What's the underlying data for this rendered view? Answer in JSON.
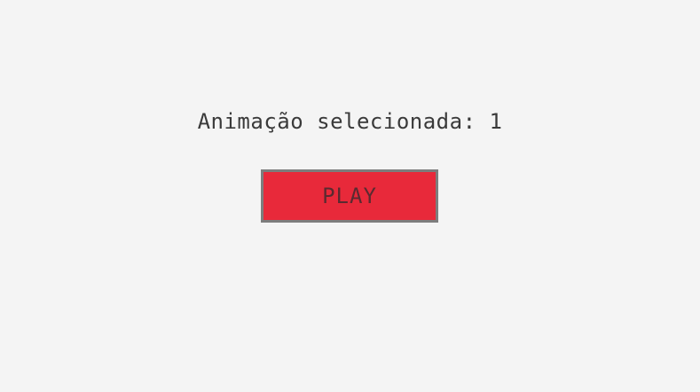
{
  "status": {
    "label": "Animação selecionada: 1"
  },
  "controls": {
    "play_label": "PLAY"
  },
  "colors": {
    "background": "#f4f4f4",
    "button_fill": "#e8293a",
    "button_border": "#7d7d7d",
    "text": "#3a3a3a"
  }
}
